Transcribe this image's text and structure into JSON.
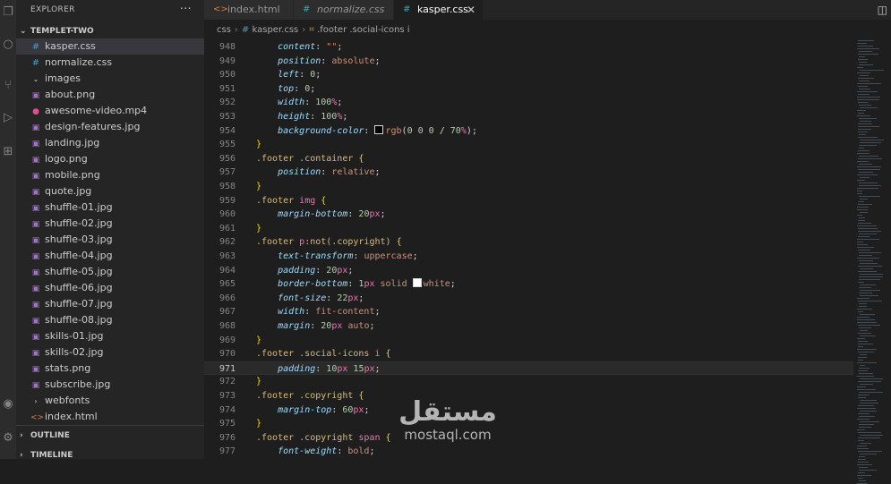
{
  "activity_icons": [
    "files-icon",
    "search-icon",
    "source-control-icon",
    "run-debug-icon",
    "extensions-icon",
    "account-icon",
    "settings-icon"
  ],
  "sidebar": {
    "title": "EXPLORER",
    "more_label": "···",
    "project": "TEMPLET-TWO",
    "items": [
      {
        "name": "kasper.css",
        "icon": "hash",
        "indent": 1,
        "selected": true
      },
      {
        "name": "normalize.css",
        "icon": "hash",
        "indent": 1
      },
      {
        "name": "images",
        "icon": "folder-open",
        "indent": 1
      },
      {
        "name": "about.png",
        "icon": "img",
        "indent": 2
      },
      {
        "name": "awesome-video.mp4",
        "icon": "vid",
        "indent": 2
      },
      {
        "name": "design-features.jpg",
        "icon": "img",
        "indent": 2
      },
      {
        "name": "landing.jpg",
        "icon": "img",
        "indent": 2
      },
      {
        "name": "logo.png",
        "icon": "img",
        "indent": 2
      },
      {
        "name": "mobile.png",
        "icon": "img",
        "indent": 2
      },
      {
        "name": "quote.jpg",
        "icon": "img",
        "indent": 2
      },
      {
        "name": "shuffle-01.jpg",
        "icon": "img",
        "indent": 2
      },
      {
        "name": "shuffle-02.jpg",
        "icon": "img",
        "indent": 2
      },
      {
        "name": "shuffle-03.jpg",
        "icon": "img",
        "indent": 2
      },
      {
        "name": "shuffle-04.jpg",
        "icon": "img",
        "indent": 2
      },
      {
        "name": "shuffle-05.jpg",
        "icon": "img",
        "indent": 2
      },
      {
        "name": "shuffle-06.jpg",
        "icon": "img",
        "indent": 2
      },
      {
        "name": "shuffle-07.jpg",
        "icon": "img",
        "indent": 2
      },
      {
        "name": "shuffle-08.jpg",
        "icon": "img",
        "indent": 2
      },
      {
        "name": "skills-01.jpg",
        "icon": "img",
        "indent": 2
      },
      {
        "name": "skills-02.jpg",
        "icon": "img",
        "indent": 2
      },
      {
        "name": "stats.png",
        "icon": "img",
        "indent": 2
      },
      {
        "name": "subscribe.jpg",
        "icon": "img",
        "indent": 2
      },
      {
        "name": "webfonts",
        "icon": "folder-closed",
        "indent": 1
      },
      {
        "name": "index.html",
        "icon": "html",
        "indent": 1
      }
    ],
    "outline": "OUTLINE",
    "timeline": "TIMELINE"
  },
  "tabs": [
    {
      "label": "index.html",
      "icon": "html"
    },
    {
      "label": "normalize.css",
      "icon": "hash",
      "italic": true
    },
    {
      "label": "kasper.css",
      "icon": "hash",
      "active": true,
      "close": "✕"
    }
  ],
  "split_icon": "split-editor-icon",
  "breadcrumb": {
    "folder": "css",
    "file": "kasper.css",
    "symbol": ".footer .social-icons i"
  },
  "editor": {
    "current_line": 971,
    "lines": [
      {
        "n": "948",
        "t": [
          [
            "    ",
            "pun"
          ],
          [
            "content",
            "prop"
          ],
          [
            ": ",
            "pun"
          ],
          [
            "\"\"",
            "val"
          ],
          [
            ";",
            "pun"
          ]
        ]
      },
      {
        "n": "949",
        "t": [
          [
            "    ",
            "pun"
          ],
          [
            "position",
            "prop"
          ],
          [
            ": ",
            "pun"
          ],
          [
            "absolute",
            "val"
          ],
          [
            ";",
            "pun"
          ]
        ]
      },
      {
        "n": "950",
        "t": [
          [
            "    ",
            "pun"
          ],
          [
            "left",
            "prop"
          ],
          [
            ": ",
            "pun"
          ],
          [
            "0",
            "num"
          ],
          [
            ";",
            "pun"
          ]
        ]
      },
      {
        "n": "951",
        "t": [
          [
            "    ",
            "pun"
          ],
          [
            "top",
            "prop"
          ],
          [
            ": ",
            "pun"
          ],
          [
            "0",
            "num"
          ],
          [
            ";",
            "pun"
          ]
        ]
      },
      {
        "n": "952",
        "t": [
          [
            "    ",
            "pun"
          ],
          [
            "width",
            "prop"
          ],
          [
            ": ",
            "pun"
          ],
          [
            "100",
            "num"
          ],
          [
            "%",
            "unit"
          ],
          [
            ";",
            "pun"
          ]
        ]
      },
      {
        "n": "953",
        "t": [
          [
            "    ",
            "pun"
          ],
          [
            "height",
            "prop"
          ],
          [
            ": ",
            "pun"
          ],
          [
            "100",
            "num"
          ],
          [
            "%",
            "unit"
          ],
          [
            ";",
            "pun"
          ]
        ]
      },
      {
        "n": "954",
        "t": [
          [
            "    ",
            "pun"
          ],
          [
            "background-color",
            "prop"
          ],
          [
            ": ",
            "pun"
          ],
          [
            "",
            "swatch-dark"
          ],
          [
            "rgb",
            "val"
          ],
          [
            "(",
            "pun"
          ],
          [
            "0 0 0",
            "num"
          ],
          [
            " / ",
            "pun"
          ],
          [
            "70",
            "num"
          ],
          [
            "%",
            "unit"
          ],
          [
            ");",
            "pun"
          ]
        ]
      },
      {
        "n": "955",
        "t": [
          [
            "}",
            "brace"
          ]
        ]
      },
      {
        "n": "956",
        "t": [
          [
            ".footer .container ",
            "sel"
          ],
          [
            "{",
            "brace"
          ]
        ]
      },
      {
        "n": "957",
        "t": [
          [
            "    ",
            "pun"
          ],
          [
            "position",
            "prop"
          ],
          [
            ": ",
            "pun"
          ],
          [
            "relative",
            "val"
          ],
          [
            ";",
            "pun"
          ]
        ]
      },
      {
        "n": "958",
        "t": [
          [
            "}",
            "brace"
          ]
        ]
      },
      {
        "n": "959",
        "t": [
          [
            ".footer ",
            "sel"
          ],
          [
            "img",
            "tag"
          ],
          [
            " ",
            "pun"
          ],
          [
            "{",
            "brace"
          ]
        ]
      },
      {
        "n": "960",
        "t": [
          [
            "    ",
            "pun"
          ],
          [
            "margin-bottom",
            "prop"
          ],
          [
            ": ",
            "pun"
          ],
          [
            "20",
            "num"
          ],
          [
            "px",
            "unit"
          ],
          [
            ";",
            "pun"
          ]
        ]
      },
      {
        "n": "961",
        "t": [
          [
            "}",
            "brace"
          ]
        ]
      },
      {
        "n": "962",
        "t": [
          [
            ".footer ",
            "sel"
          ],
          [
            "p",
            "tag"
          ],
          [
            ":not(.copyright) ",
            "sel"
          ],
          [
            "{",
            "brace"
          ]
        ]
      },
      {
        "n": "963",
        "t": [
          [
            "    ",
            "pun"
          ],
          [
            "text-transform",
            "prop"
          ],
          [
            ": ",
            "pun"
          ],
          [
            "uppercase",
            "val"
          ],
          [
            ";",
            "pun"
          ]
        ]
      },
      {
        "n": "964",
        "t": [
          [
            "    ",
            "pun"
          ],
          [
            "padding",
            "prop"
          ],
          [
            ": ",
            "pun"
          ],
          [
            "20",
            "num"
          ],
          [
            "px",
            "unit"
          ],
          [
            ";",
            "pun"
          ]
        ]
      },
      {
        "n": "965",
        "t": [
          [
            "    ",
            "pun"
          ],
          [
            "border-bottom",
            "prop"
          ],
          [
            ": ",
            "pun"
          ],
          [
            "1",
            "num"
          ],
          [
            "px",
            "unit"
          ],
          [
            " solid ",
            "val"
          ],
          [
            "",
            "swatch-white"
          ],
          [
            "white",
            "val"
          ],
          [
            ";",
            "pun"
          ]
        ]
      },
      {
        "n": "966",
        "t": [
          [
            "    ",
            "pun"
          ],
          [
            "font-size",
            "prop"
          ],
          [
            ": ",
            "pun"
          ],
          [
            "22",
            "num"
          ],
          [
            "px",
            "unit"
          ],
          [
            ";",
            "pun"
          ]
        ]
      },
      {
        "n": "967",
        "t": [
          [
            "    ",
            "pun"
          ],
          [
            "width",
            "prop"
          ],
          [
            ": ",
            "pun"
          ],
          [
            "fit-content",
            "val"
          ],
          [
            ";",
            "pun"
          ]
        ]
      },
      {
        "n": "968",
        "t": [
          [
            "    ",
            "pun"
          ],
          [
            "margin",
            "prop"
          ],
          [
            ": ",
            "pun"
          ],
          [
            "20",
            "num"
          ],
          [
            "px",
            "unit"
          ],
          [
            " auto",
            "val"
          ],
          [
            ";",
            "pun"
          ]
        ]
      },
      {
        "n": "969",
        "t": [
          [
            "}",
            "brace"
          ]
        ]
      },
      {
        "n": "970",
        "t": [
          [
            ".footer .social-icons ",
            "sel"
          ],
          [
            "i",
            "tag"
          ],
          [
            " ",
            "pun"
          ],
          [
            "{",
            "brace"
          ]
        ]
      },
      {
        "n": "971",
        "t": [
          [
            "    ",
            "pun"
          ],
          [
            "padding",
            "prop"
          ],
          [
            ": ",
            "pun"
          ],
          [
            "10",
            "num"
          ],
          [
            "px",
            "unit"
          ],
          [
            " ",
            "pun"
          ],
          [
            "15",
            "num"
          ],
          [
            "px",
            "unit"
          ],
          [
            ";",
            "pun"
          ]
        ]
      },
      {
        "n": "972",
        "t": [
          [
            "}",
            "brace"
          ]
        ]
      },
      {
        "n": "973",
        "t": [
          [
            ".footer .copyright ",
            "sel"
          ],
          [
            "{",
            "brace"
          ]
        ]
      },
      {
        "n": "974",
        "t": [
          [
            "    ",
            "pun"
          ],
          [
            "margin-top",
            "prop"
          ],
          [
            ": ",
            "pun"
          ],
          [
            "60",
            "num"
          ],
          [
            "px",
            "unit"
          ],
          [
            ";",
            "pun"
          ]
        ]
      },
      {
        "n": "975",
        "t": [
          [
            "}",
            "brace"
          ]
        ]
      },
      {
        "n": "976",
        "t": [
          [
            ".footer .copyright ",
            "sel"
          ],
          [
            "span",
            "tag"
          ],
          [
            " ",
            "pun"
          ],
          [
            "{",
            "brace"
          ]
        ]
      },
      {
        "n": "977",
        "t": [
          [
            "    ",
            "pun"
          ],
          [
            "font-weight",
            "prop"
          ],
          [
            ": ",
            "pun"
          ],
          [
            "bold",
            "val"
          ],
          [
            ";",
            "pun"
          ]
        ]
      }
    ]
  },
  "watermark": {
    "arabic": "مستقل",
    "latin": "mostaql.com"
  }
}
